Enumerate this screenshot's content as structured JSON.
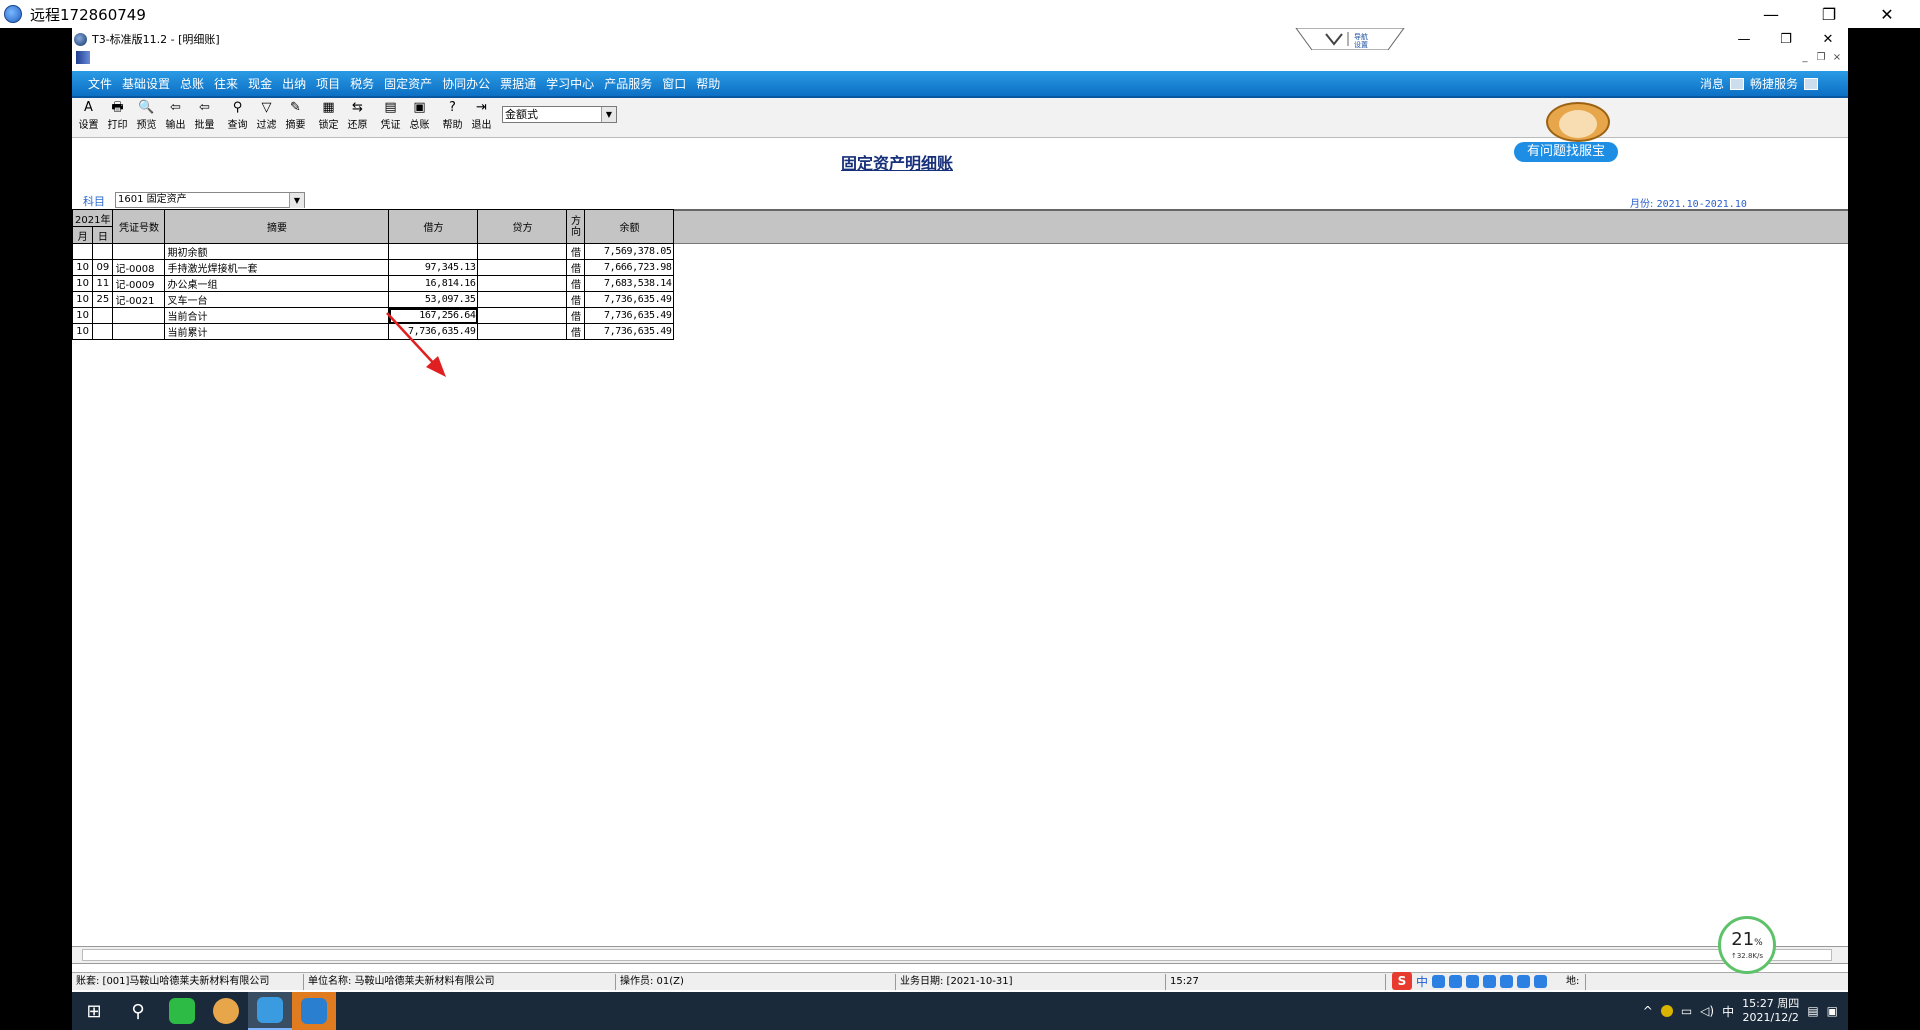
{
  "outer_window": {
    "title": "远程172860749",
    "minimize": "—",
    "restore": "❐",
    "close": "✕"
  },
  "app_window": {
    "title": "T3-标准版11.2 - [明细账]",
    "minimize": "—",
    "restore": "❐",
    "close": "✕",
    "ribbon_tab_text": "导航\n设置"
  },
  "menu": {
    "items": [
      "文件",
      "基础设置",
      "总账",
      "往来",
      "现金",
      "出纳",
      "项目",
      "税务",
      "固定资产",
      "协同办公",
      "票据通",
      "学习中心",
      "产品服务",
      "窗口",
      "帮助"
    ],
    "right": {
      "message": "消息",
      "online_service": "畅捷服务"
    }
  },
  "toolbar": {
    "buttons": [
      {
        "label": "设置",
        "icon": "settings-icon",
        "glyph": "A"
      },
      {
        "label": "打印",
        "icon": "printer-icon",
        "glyph": "🖶"
      },
      {
        "label": "预览",
        "icon": "preview-icon",
        "glyph": "🔍"
      },
      {
        "label": "输出",
        "icon": "export-icon",
        "glyph": "⇦"
      },
      {
        "label": "批量",
        "icon": "batch-icon",
        "glyph": "⇦"
      },
      {
        "label": "查询",
        "icon": "binoculars-icon",
        "glyph": "⚲"
      },
      {
        "label": "过滤",
        "icon": "filter-icon",
        "glyph": "▽"
      },
      {
        "label": "摘要",
        "icon": "summary-icon",
        "glyph": "✎"
      },
      {
        "label": "锁定",
        "icon": "lock-icon",
        "glyph": "▦"
      },
      {
        "label": "还原",
        "icon": "restore-icon",
        "glyph": "⇆"
      },
      {
        "label": "凭证",
        "icon": "voucher-icon",
        "glyph": "▤"
      },
      {
        "label": "总账",
        "icon": "ledger-icon",
        "glyph": "▣"
      },
      {
        "label": "帮助",
        "icon": "help-icon",
        "glyph": "?"
      },
      {
        "label": "退出",
        "icon": "exit-icon",
        "glyph": "⇥"
      }
    ],
    "format_select": "金额式"
  },
  "assistant": {
    "button_label": "有问题找服宝"
  },
  "report": {
    "title": "固定资产明细账",
    "subject_label": "科目",
    "subject_value": "1601 固定资产",
    "month_label": "月份:",
    "month_value": "2021.10-2021.10"
  },
  "table": {
    "year": "2021年",
    "month_header": "月",
    "day_header": "日",
    "voucher_header": "凭证号数",
    "summary_header": "摘要",
    "debit_header": "借方",
    "credit_header": "贷方",
    "direction_header": "方向",
    "balance_header": "余额",
    "rows": [
      {
        "month": "",
        "day": "",
        "voucher": "",
        "summary": "期初余额",
        "debit": "",
        "credit": "",
        "direction": "借",
        "balance": "7,569,378.05"
      },
      {
        "month": "10",
        "day": "09",
        "voucher": "记-0008",
        "summary": "手持激光焊接机一套",
        "debit": "97,345.13",
        "credit": "",
        "direction": "借",
        "balance": "7,666,723.98"
      },
      {
        "month": "10",
        "day": "11",
        "voucher": "记-0009",
        "summary": "办公桌一组",
        "debit": "16,814.16",
        "credit": "",
        "direction": "借",
        "balance": "7,683,538.14"
      },
      {
        "month": "10",
        "day": "25",
        "voucher": "记-0021",
        "summary": "叉车一台",
        "debit": "53,097.35",
        "credit": "",
        "direction": "借",
        "balance": "7,736,635.49"
      },
      {
        "month": "10",
        "day": "",
        "voucher": "",
        "summary": "当前合计",
        "debit": "167,256.64",
        "credit": "",
        "direction": "借",
        "balance": "7,736,635.49"
      },
      {
        "month": "10",
        "day": "",
        "voucher": "",
        "summary": "当前累计",
        "debit": "7,736,635.49",
        "credit": "",
        "direction": "借",
        "balance": "7,736,635.49"
      }
    ]
  },
  "status": {
    "account_set": "账套: [001]马鞍山哈德莱夫新材料有限公司",
    "unit_name": "单位名称: 马鞍山哈德莱夫新材料有限公司",
    "operator": "操作员: 01(Z)",
    "business_date": "业务日期: [2021-10-31]",
    "time": "15:27",
    "location": "地:"
  },
  "ime": {
    "text": "中"
  },
  "network_widget": {
    "percent": "21",
    "unit": "%",
    "speed": "↑32.8K/s"
  },
  "taskbar": {
    "tray_lang": "中",
    "time": "15:27 周四",
    "date": "2021/12/2"
  },
  "colors": {
    "menu_blue": "#0c6fc4",
    "title_navy": "#17307a",
    "header_gray": "#c4c4c4",
    "arrow_red": "#e02020"
  }
}
